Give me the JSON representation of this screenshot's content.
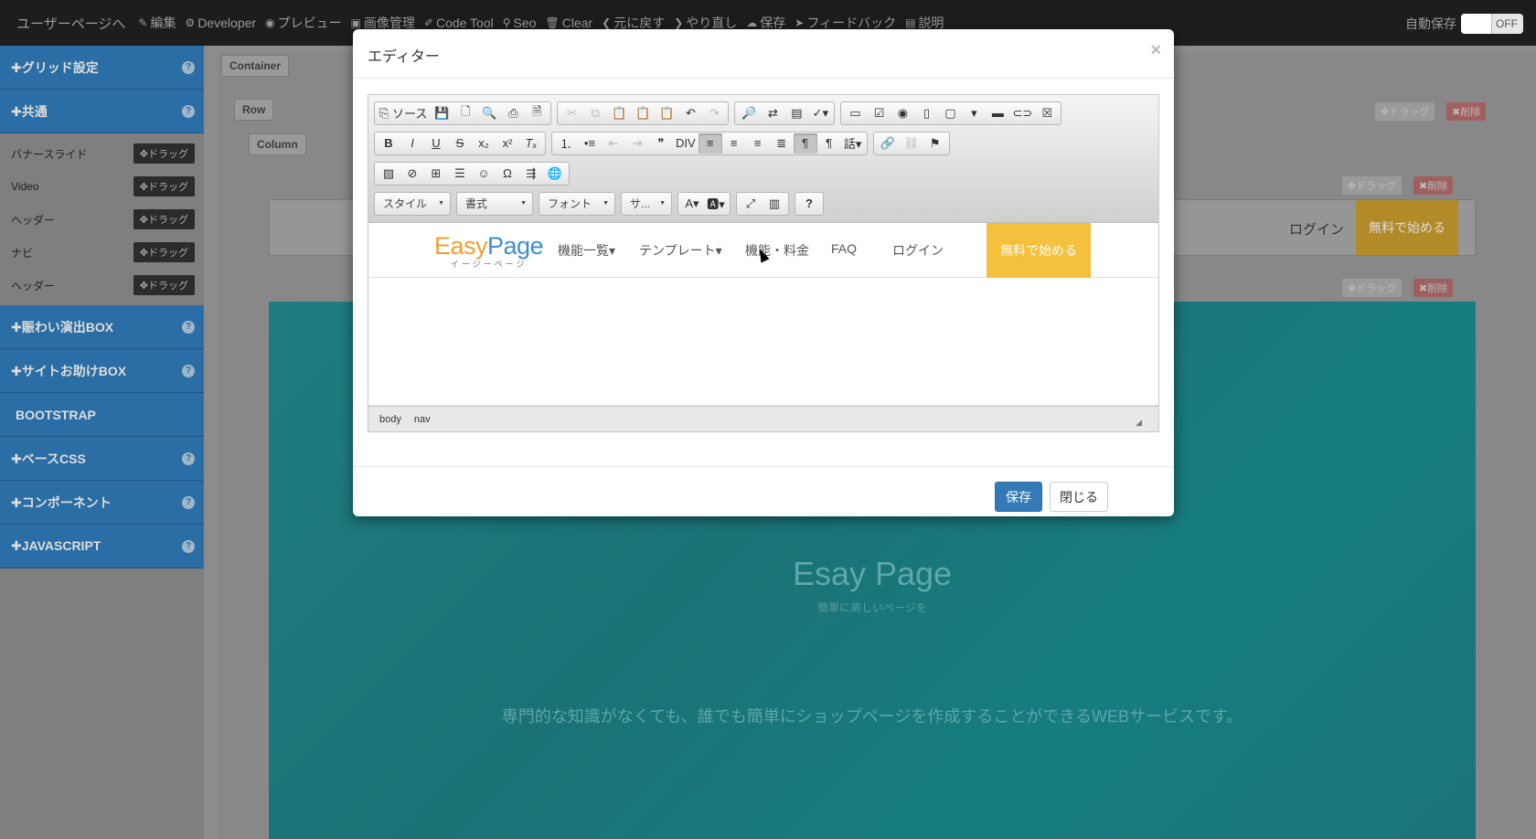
{
  "topbar": {
    "brand": "ユーザーページへ",
    "items": [
      {
        "icon": "✎",
        "label": "編集"
      },
      {
        "icon": "⚙",
        "label": "Developer"
      },
      {
        "icon": "◉",
        "label": "プレビュー"
      },
      {
        "icon": "▣",
        "label": "画像管理"
      },
      {
        "icon": "✐",
        "label": "Code Tool"
      },
      {
        "icon": "⚲",
        "label": "Seo"
      },
      {
        "icon": "🗑",
        "label": "Clear"
      },
      {
        "icon": "❮",
        "label": "元に戻す"
      },
      {
        "icon": "❯",
        "label": "やり直し"
      },
      {
        "icon": "☁",
        "label": "保存"
      },
      {
        "icon": "➤",
        "label": "フィードバック"
      },
      {
        "icon": "▤",
        "label": "説明"
      }
    ],
    "autosave_label": "自動保存",
    "toggle_state": "OFF"
  },
  "sidebar": {
    "sections": [
      {
        "label": "✚グリッド設定",
        "help": "?"
      },
      {
        "label": "✚共通",
        "help": "?"
      }
    ],
    "items": [
      {
        "label": "バナースライド",
        "drag": "✥ドラッグ"
      },
      {
        "label": "Video",
        "drag": "✥ドラッグ"
      },
      {
        "label": "ヘッダー",
        "drag": "✥ドラッグ"
      },
      {
        "label": "ナビ",
        "drag": "✥ドラッグ"
      },
      {
        "label": "ヘッダー",
        "drag": "✥ドラッグ"
      }
    ],
    "sections2": [
      {
        "label": "✚賑わい演出BOX",
        "help": "?"
      },
      {
        "label": "✚サイトお助けBOX",
        "help": "?"
      },
      {
        "label": "BOOTSTRAP",
        "help": ""
      },
      {
        "label": "✚ベースCSS",
        "help": "?"
      },
      {
        "label": "✚コンポーネント",
        "help": "?"
      },
      {
        "label": "✚JAVASCRIPT",
        "help": "?"
      }
    ]
  },
  "canvas": {
    "container_label": "Container",
    "row_label": "Row",
    "column_label": "Column",
    "drag": "✥ドラッグ",
    "delete": "✖削除",
    "bg_login": "ログイン",
    "bg_cta": "無料で始める",
    "hero_title": "Esay Page",
    "hero_sub": "簡単に美しいページを",
    "hero_desc": "専門的な知識がなくても、誰でも簡単にショップページを作成することができるWEBサービスです。"
  },
  "modal": {
    "title": "エディター",
    "close_x": "×",
    "toolbar": {
      "source": "ソース",
      "styles": "スタイル",
      "format": "書式",
      "font": "フォント",
      "size": "サ..."
    },
    "content": {
      "logo_easy": "Easy",
      "logo_page": "Page",
      "logo_sub": "イージーページ",
      "nav": [
        "機能一覧▾",
        "テンプレート▾",
        "機能・料金",
        "FAQ",
        "ログイン"
      ],
      "cta": "無料で始める"
    },
    "pathbar": [
      "body",
      "nav"
    ],
    "save": "保存",
    "close": "閉じる"
  }
}
